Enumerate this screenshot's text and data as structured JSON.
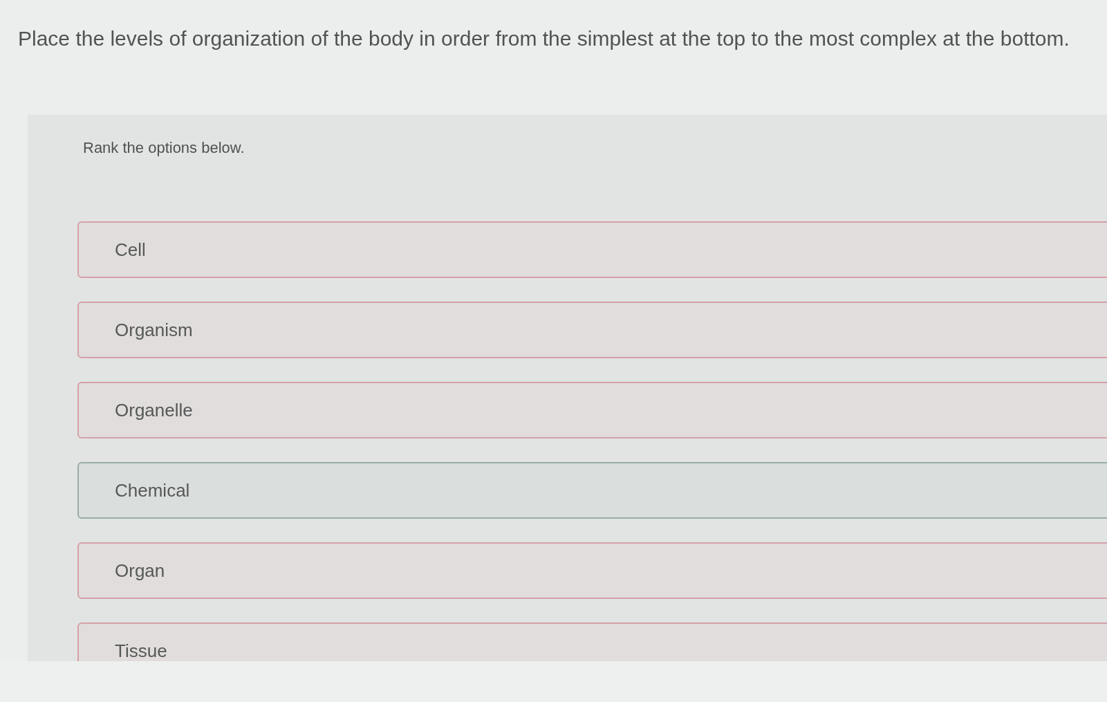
{
  "question": {
    "prompt": "Place the levels of organization of the body in order from the simplest at the top to the most complex at the bottom."
  },
  "ranking": {
    "instruction": "Rank the options below.",
    "options": [
      {
        "label": "Cell",
        "color": "#d4a0a8"
      },
      {
        "label": "Organism",
        "color": "#d4a0a8"
      },
      {
        "label": "Organelle",
        "color": "#d4a0a8"
      },
      {
        "label": "Chemical",
        "color": "#98ada3"
      },
      {
        "label": "Organ",
        "color": "#d4a0a8"
      },
      {
        "label": "Tissue",
        "color": "#d4a0a8"
      }
    ]
  }
}
